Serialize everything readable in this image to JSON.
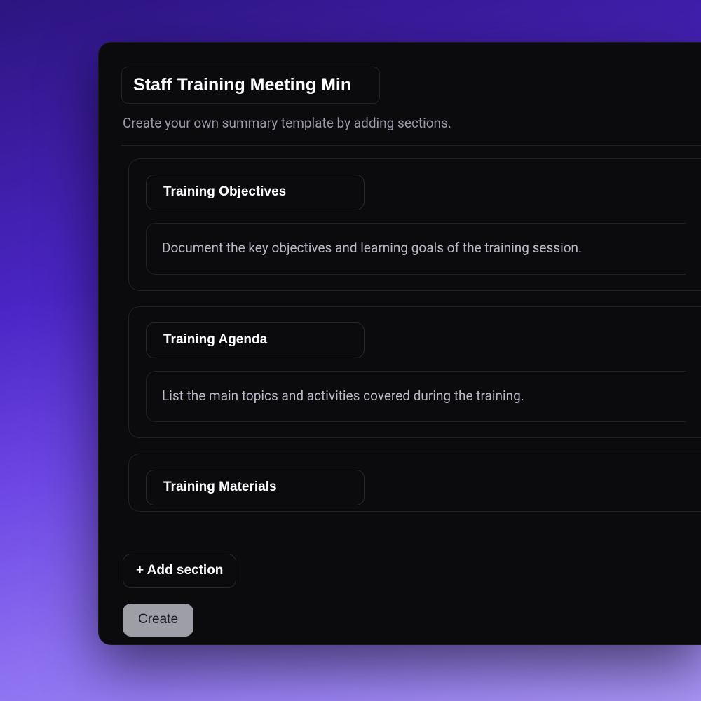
{
  "template": {
    "title": "Staff Training Meeting Min",
    "subtitle": "Create your own summary template by adding sections.",
    "sections": [
      {
        "title": "Training Objectives",
        "description": "Document the key objectives and learning goals of the training session."
      },
      {
        "title": "Training Agenda",
        "description": "List the main topics and activities covered during the training."
      },
      {
        "title": "Training Materials",
        "description": ""
      }
    ],
    "add_section_label": "+ Add section",
    "create_label": "Create"
  }
}
